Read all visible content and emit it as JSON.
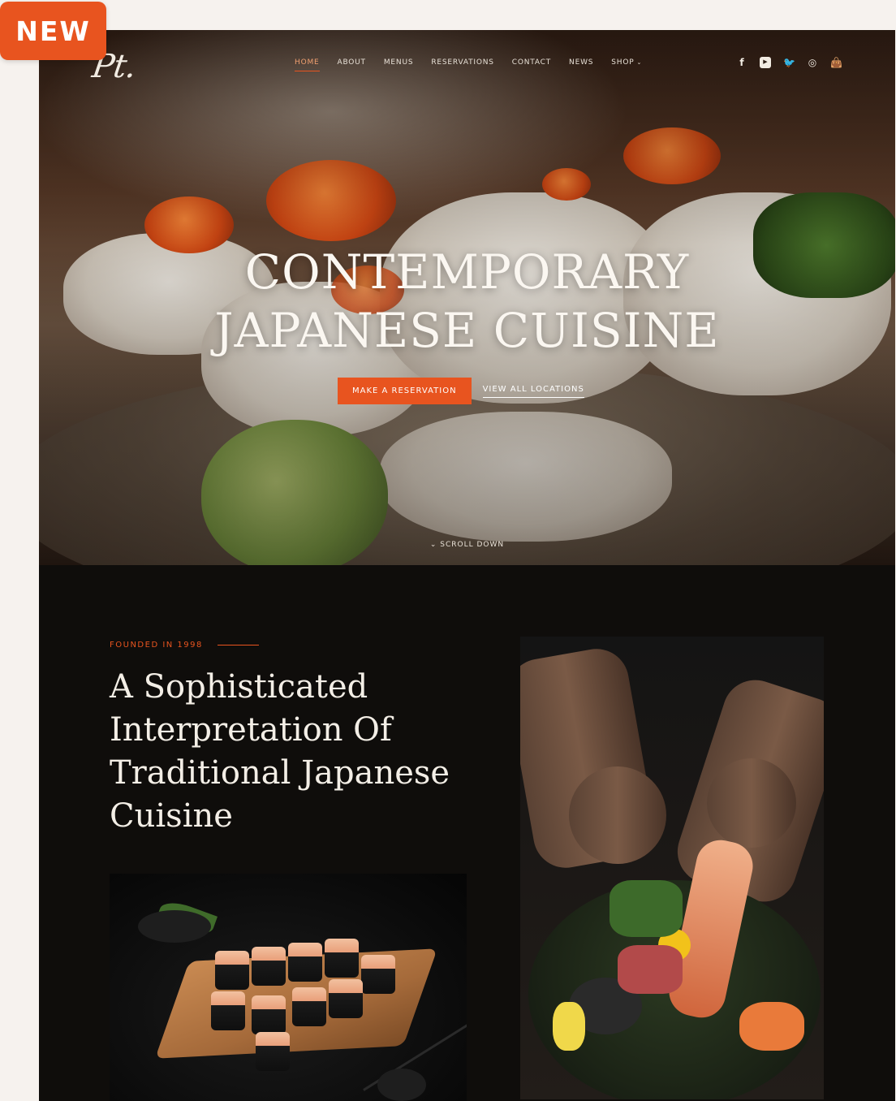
{
  "badge": {
    "label": "NEW"
  },
  "brand": {
    "logo_text": "Pt.",
    "accent": "#e8541f"
  },
  "nav": {
    "items": [
      {
        "label": "HOME",
        "active": true
      },
      {
        "label": "ABOUT"
      },
      {
        "label": "MENUS"
      },
      {
        "label": "RESERVATIONS"
      },
      {
        "label": "CONTACT"
      },
      {
        "label": "NEWS"
      },
      {
        "label": "SHOP"
      }
    ],
    "shop_chevron": "⌄"
  },
  "social": {
    "icons": [
      "facebook-icon",
      "youtube-icon",
      "twitter-icon",
      "instagram-icon",
      "shopping-bag-icon"
    ],
    "glyphs": [
      "f",
      "▶",
      "🐦",
      "◎",
      "👜"
    ]
  },
  "hero": {
    "title_line1": "CONTEMPORARY",
    "title_line2": "JAPANESE CUISINE",
    "primary_cta": "MAKE A RESERVATION",
    "secondary_cta": "VIEW ALL LOCATIONS",
    "scroll_label": "SCROLL DOWN",
    "scroll_glyph": "⌄"
  },
  "about": {
    "eyebrow": "FOUNDED IN 1998",
    "title": "A Sophisticated Interpretation Of Traditional Japanese Cuisine"
  }
}
